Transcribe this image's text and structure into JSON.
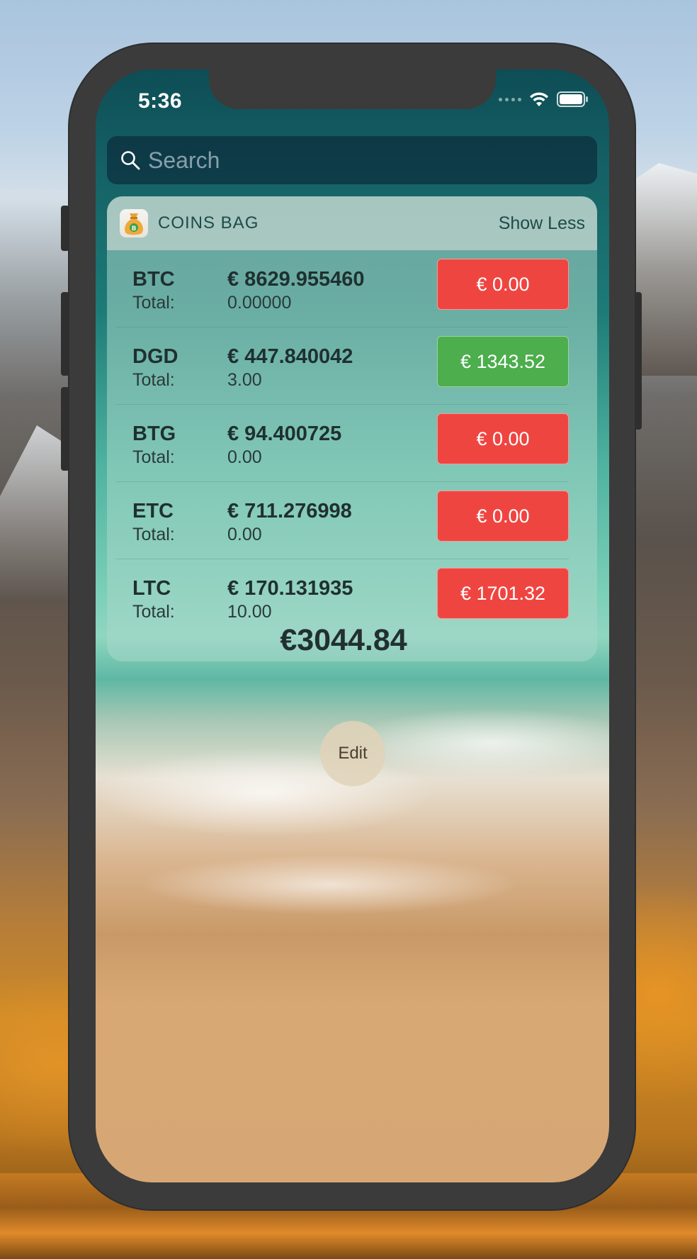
{
  "status_bar": {
    "time": "5:36"
  },
  "search": {
    "placeholder": "Search"
  },
  "widget": {
    "app_name": "COINS BAG",
    "toggle_label": "Show Less",
    "rows": [
      {
        "symbol": "BTC",
        "total_label": "Total:",
        "price": "€ 8629.955460",
        "amount": "0.00000",
        "value": "€ 0.00",
        "value_color": "#ef4541"
      },
      {
        "symbol": "DGD",
        "total_label": "Total:",
        "price": "€ 447.840042",
        "amount": "3.00",
        "value": "€ 1343.52",
        "value_color": "#4cae4c"
      },
      {
        "symbol": "BTG",
        "total_label": "Total:",
        "price": "€ 94.400725",
        "amount": "0.00",
        "value": "€ 0.00",
        "value_color": "#ef4541"
      },
      {
        "symbol": "ETC",
        "total_label": "Total:",
        "price": "€ 711.276998",
        "amount": "0.00",
        "value": "€ 0.00",
        "value_color": "#ef4541"
      },
      {
        "symbol": "LTC",
        "total_label": "Total:",
        "price": "€ 170.131935",
        "amount": "10.00",
        "value": "€ 1701.32",
        "value_color": "#ef4541"
      }
    ],
    "grand_total": "€3044.84"
  },
  "edit_button": {
    "label": "Edit"
  },
  "icons": [
    "search-icon",
    "wifi-icon",
    "battery-icon",
    "signal-icon",
    "money-bag-icon"
  ]
}
